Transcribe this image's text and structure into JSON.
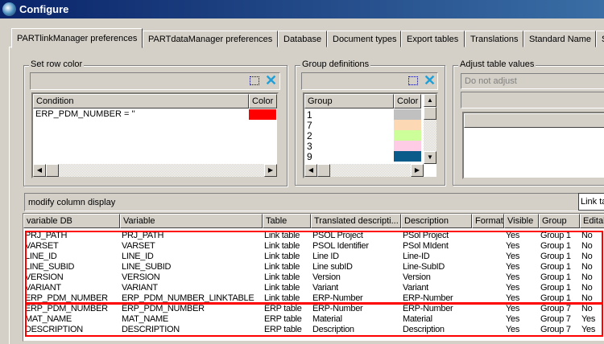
{
  "window": {
    "title": "Configure"
  },
  "tabs": [
    "PARTlinkManager preferences",
    "PARTdataManager preferences",
    "Database",
    "Document types",
    "Export tables",
    "Translations",
    "Standard Name",
    "S"
  ],
  "row_color": {
    "label": "Set row color",
    "columns": [
      "Condition",
      "Color"
    ],
    "rows": [
      {
        "condition": "ERP_PDM_NUMBER = ''",
        "color": "#ff0000"
      }
    ]
  },
  "group_defs": {
    "label": "Group definitions",
    "columns": [
      "Group",
      "Color"
    ],
    "rows": [
      {
        "group": "1",
        "color": "#c0c0c0"
      },
      {
        "group": "7",
        "color": "#fcd8b4"
      },
      {
        "group": "2",
        "color": "#ccff99"
      },
      {
        "group": "3",
        "color": "#ffcce6"
      },
      {
        "group": "9",
        "color": "#0a5a8a"
      }
    ]
  },
  "adjust": {
    "label": "Adjust table values",
    "dropdown": "Do not adjust"
  },
  "modify": {
    "label": "modify column display",
    "dropdown": "Link ta"
  },
  "table": {
    "columns": [
      "variable DB",
      "Variable",
      "Table",
      "Translated descripti...",
      "Description",
      "Format",
      "Visible",
      "Group",
      "Editab"
    ],
    "rows": [
      [
        "PRJ_PATH",
        "PRJ_PATH",
        "Link table",
        "PSOL Project",
        "PSol Project",
        "",
        "Yes",
        "Group 1",
        "No"
      ],
      [
        "VARSET",
        "VARSET",
        "Link table",
        "PSOL Identifier",
        "PSol MIdent",
        "",
        "Yes",
        "Group 1",
        "No"
      ],
      [
        "LINE_ID",
        "LINE_ID",
        "Link table",
        "Line ID",
        "Line-ID",
        "",
        "Yes",
        "Group 1",
        "No"
      ],
      [
        "LINE_SUBID",
        "LINE_SUBID",
        "Link table",
        "Line subID",
        "Line-SubID",
        "",
        "Yes",
        "Group 1",
        "No"
      ],
      [
        "VERSION",
        "VERSION",
        "Link table",
        "Version",
        "Version",
        "",
        "Yes",
        "Group 1",
        "No"
      ],
      [
        "VARIANT",
        "VARIANT",
        "Link table",
        "Variant",
        "Variant",
        "",
        "Yes",
        "Group 1",
        "No"
      ],
      [
        "ERP_PDM_NUMBER",
        "ERP_PDM_NUMBER_LINKTABLE",
        "Link table",
        "ERP-Number",
        "ERP-Number",
        "",
        "Yes",
        "Group 1",
        "No"
      ],
      [
        "ERP_PDM_NUMBER",
        "ERP_PDM_NUMBER",
        "ERP table",
        "ERP-Number",
        "ERP-Number",
        "",
        "Yes",
        "Group 7",
        "No"
      ],
      [
        "MAT_NAME",
        "MAT_NAME",
        "ERP table",
        "Material",
        "Material",
        "",
        "Yes",
        "Group 7",
        "Yes"
      ],
      [
        "DESCRIPTION",
        "DESCRIPTION",
        "ERP table",
        "Description",
        "Description",
        "",
        "Yes",
        "Group 7",
        "Yes"
      ]
    ]
  }
}
